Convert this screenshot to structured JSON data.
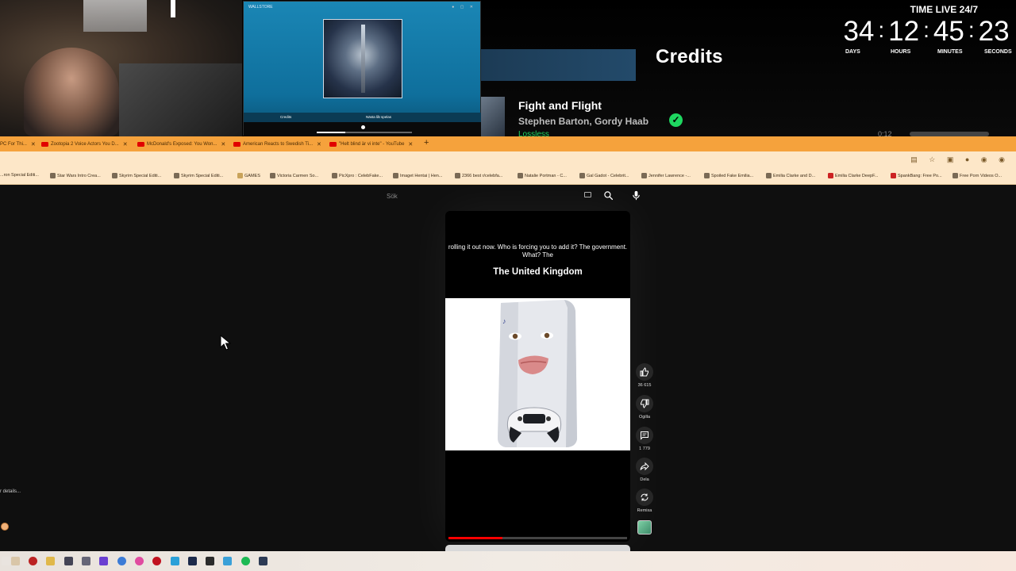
{
  "overlay": {
    "mini_player_title": "WALLSTORE",
    "mini_tabs": [
      "Credits",
      "Nästa låt spelas"
    ],
    "credits_heading": "Credits",
    "track_title": "Fight and Flight",
    "track_artists": "Stephen Barton, Gordy Haab",
    "lossless_label": "Lossless",
    "volume_value": "0:12"
  },
  "timer": {
    "label": "TIME LIVE 24/7",
    "days": "34",
    "hours": "12",
    "minutes": "45",
    "seconds": "23",
    "units": [
      "DAYS",
      "HOURS",
      "MINUTES",
      "SECONDS"
    ]
  },
  "browser": {
    "accent": "#f5a23c",
    "tabs": [
      "PC For Thi...",
      "Zootopia 2 Voice Actors You D...",
      "McDonald's Exposed: You Won...",
      "American Reacts to Swedish Ti...",
      "\"Helt blind är vi inte\" - YouTube"
    ],
    "new_tab": "+",
    "bookmarks": [
      "...ron Special Editi...",
      "Star Wars Intro Crea...",
      "Skyrim Special Editi...",
      "Skyrim Special Editi...",
      "GAMES",
      "Victoria Carmen So...",
      "PicXpro : CelebFake...",
      "Imaget Hentai | Hen...",
      "2366 best r/celebfa...",
      "Natalie Portman - C...",
      "Gal Gadot - Celebrit...",
      "Jennifer Lawrence -...",
      "Spoiled Fake Emilia...",
      "Emilia Clarke and D...",
      "Emilia Clarke DeepF...",
      "SpankBang: Free Po...",
      "Free Porn Videos O..."
    ]
  },
  "search": {
    "placeholder": "Sök"
  },
  "short": {
    "caption_small": "rolling it out now. Who is forcing you to add it? The government. What? The",
    "caption_big": "The United Kingdom",
    "progress": 0.3
  },
  "actions": {
    "like_count": "36 615",
    "dislike_label": "Ogilla",
    "comment_count": "1 779",
    "share_label": "Dela",
    "remix_label": "Remixa"
  },
  "misc": {
    "details_chip": "r details..."
  },
  "icons": [
    "thumbs-up-icon",
    "thumbs-down-icon",
    "comment-icon",
    "share-icon",
    "remix-icon",
    "search-icon",
    "mic-icon",
    "keyboard-icon",
    "check-icon"
  ]
}
